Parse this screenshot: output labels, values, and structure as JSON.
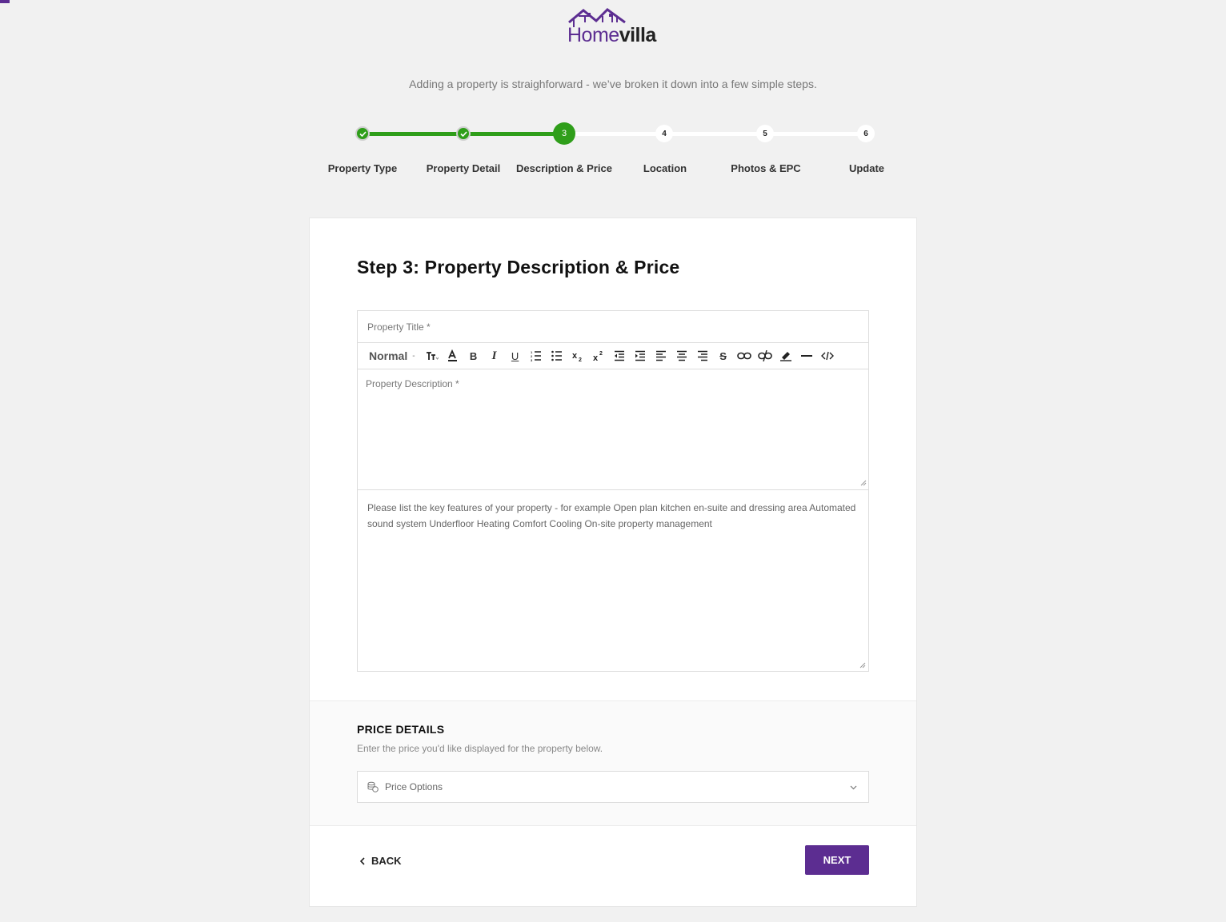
{
  "brand": {
    "logo_home": "Home",
    "logo_villa": "villa",
    "primary_color": "#5c2d91"
  },
  "tagline": "Adding a property is straighforward - we’ve broken it down into a few simple steps.",
  "stepper": {
    "steps": [
      {
        "number": "1",
        "label": "Property Type",
        "state": "done"
      },
      {
        "number": "2",
        "label": "Property Detail",
        "state": "done"
      },
      {
        "number": "3",
        "label": "Description & Price",
        "state": "current"
      },
      {
        "number": "4",
        "label": "Location",
        "state": "todo"
      },
      {
        "number": "5",
        "label": "Photos & EPC",
        "state": "todo"
      },
      {
        "number": "6",
        "label": "Update",
        "state": "todo"
      }
    ],
    "done_color": "#2f9e1a"
  },
  "form": {
    "title": "Step 3: Property Description & Price",
    "property_title_placeholder": "Property Title *",
    "toolbar": {
      "format_label": "Normal",
      "buttons": [
        "font-size-icon",
        "font-color-icon",
        "bold-icon",
        "italic-icon",
        "underline-icon",
        "ordered-list-icon",
        "unordered-list-icon",
        "subscript-icon",
        "superscript-icon",
        "outdent-icon",
        "indent-icon",
        "align-left-icon",
        "align-center-icon",
        "align-right-icon",
        "strikethrough-icon",
        "link-icon",
        "unlink-icon",
        "highlight-icon",
        "horizontal-rule-icon",
        "code-view-icon"
      ]
    },
    "description_placeholder": "Property Description *",
    "features_placeholder": "Please list the key features of your property - for example Open plan kitchen en-suite and dressing area Automated sound system Underfloor Heating Comfort Cooling On-site property management"
  },
  "price": {
    "title": "PRICE DETAILS",
    "subtitle": "Enter the price you'd like displayed for the property below.",
    "select_label": "Price Options"
  },
  "nav": {
    "back_label": "BACK",
    "next_label": "NEXT"
  }
}
